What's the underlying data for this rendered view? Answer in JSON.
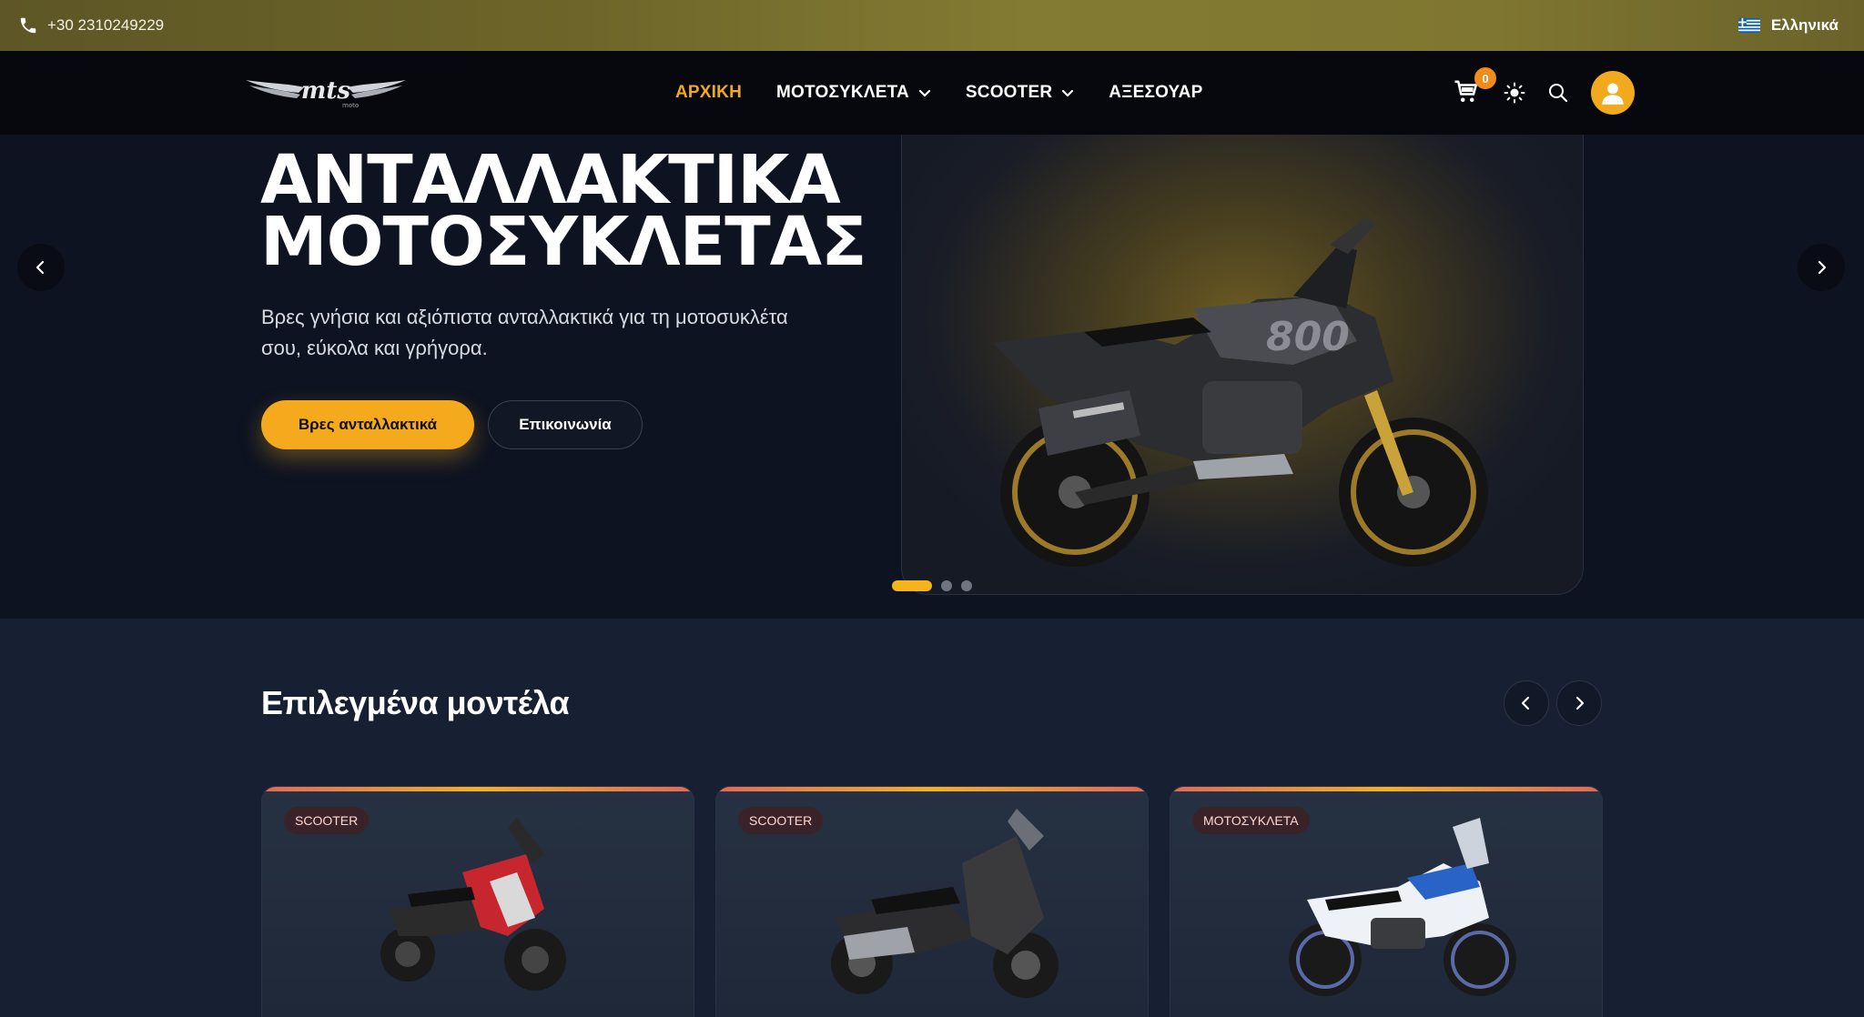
{
  "topbar": {
    "phone": "+30 2310249229",
    "phone_icon": "phone-icon",
    "language": "Ελληνικά",
    "flag_icon": "greek-flag-icon"
  },
  "nav": {
    "logo_text": "mts moto",
    "items": [
      {
        "label": "ΑΡΧΙΚΗ",
        "active": true
      },
      {
        "label": "ΜΟΤΟΣΥΚΛΕΤΑ",
        "dropdown": true
      },
      {
        "label": "SCOOTER",
        "dropdown": true
      },
      {
        "label": "ΑΞΕΣΟΥΑΡ"
      }
    ],
    "cart_count": "0",
    "icons": [
      "cart-icon",
      "theme-toggle-icon",
      "search-icon",
      "user-avatar-icon"
    ]
  },
  "hero": {
    "title_line1": "ΑΝΤΑΛΛΑΚΤΙΚΑ",
    "title_line2": "ΜΟΤΟΣΥΚΛΕΤΑΣ",
    "subtitle": "Βρες γνήσια και αξιόπιστα ανταλλακτικά για τη μοτοσυκλέτα σου, εύκολα και γρήγορα.",
    "primary_button": "Βρες ανταλλακτικά",
    "secondary_button": "Επικοινωνία",
    "slides": 3,
    "active_slide": 1
  },
  "featured": {
    "title": "Επιλεγμένα μοντέλα",
    "cards": [
      {
        "tag": "SCOOTER"
      },
      {
        "tag": "SCOOTER"
      },
      {
        "tag": "ΜΟΤΟΣΥΚΛΕΤΑ"
      }
    ]
  },
  "colors": {
    "accent": "#f5a91c",
    "nav_bg": "#06080d",
    "hero_bg": "#0d1321",
    "section_bg": "#172033"
  }
}
